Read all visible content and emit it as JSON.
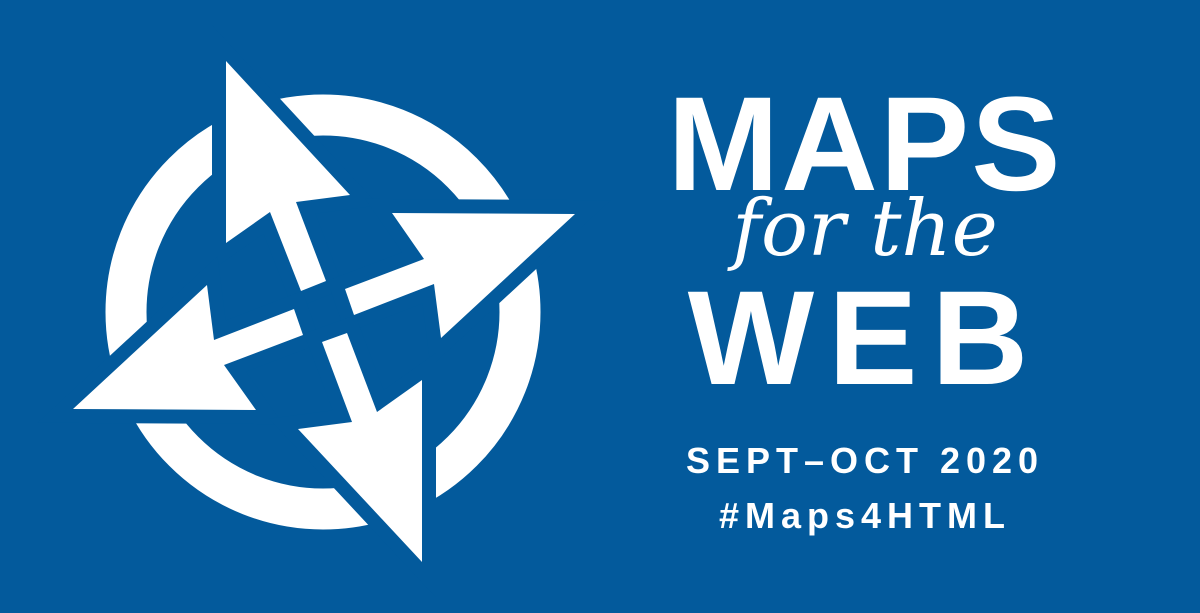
{
  "banner": {
    "line1": "MAPS",
    "line2": "for the",
    "line3": "WEB",
    "dates": "SEPT–OCT 2020",
    "hashtag": "#Maps4HTML"
  },
  "colors": {
    "background": "#035a9c",
    "foreground": "#ffffff"
  },
  "logo": {
    "icon": "compass-arrows-icon"
  }
}
